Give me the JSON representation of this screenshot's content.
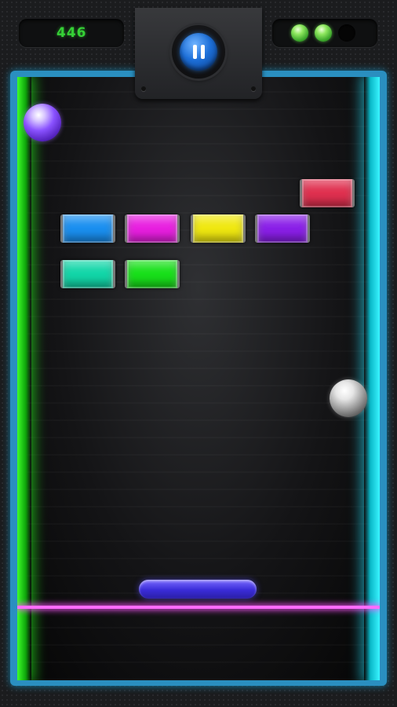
{
  "hud": {
    "score": "446",
    "lives_remaining": 2,
    "lives_total": 3
  },
  "colors": {
    "left_wall": "#1fe51a",
    "right_wall": "#25e6f5",
    "frame": "#2a8fc0",
    "deadline": "#ff6cff",
    "paddle": "#4a3cf0",
    "pause_button": "#1d6fd8"
  },
  "icons": {
    "pause": "pause-icon",
    "life": "green-orb"
  },
  "bricks": [
    {
      "color": "#e0304f",
      "name": "brick-red"
    },
    {
      "color": "#1a8ff0",
      "name": "brick-blue"
    },
    {
      "color": "#e81fe0",
      "name": "brick-magenta"
    },
    {
      "color": "#f0e810",
      "name": "brick-yellow"
    },
    {
      "color": "#8a1fe8",
      "name": "brick-purple"
    },
    {
      "color": "#12d6a8",
      "name": "brick-teal"
    },
    {
      "color": "#18e01a",
      "name": "brick-green"
    }
  ],
  "balls": [
    {
      "color": "purple",
      "name": "purple-ball"
    },
    {
      "color": "silver",
      "name": "silver-ball"
    }
  ]
}
